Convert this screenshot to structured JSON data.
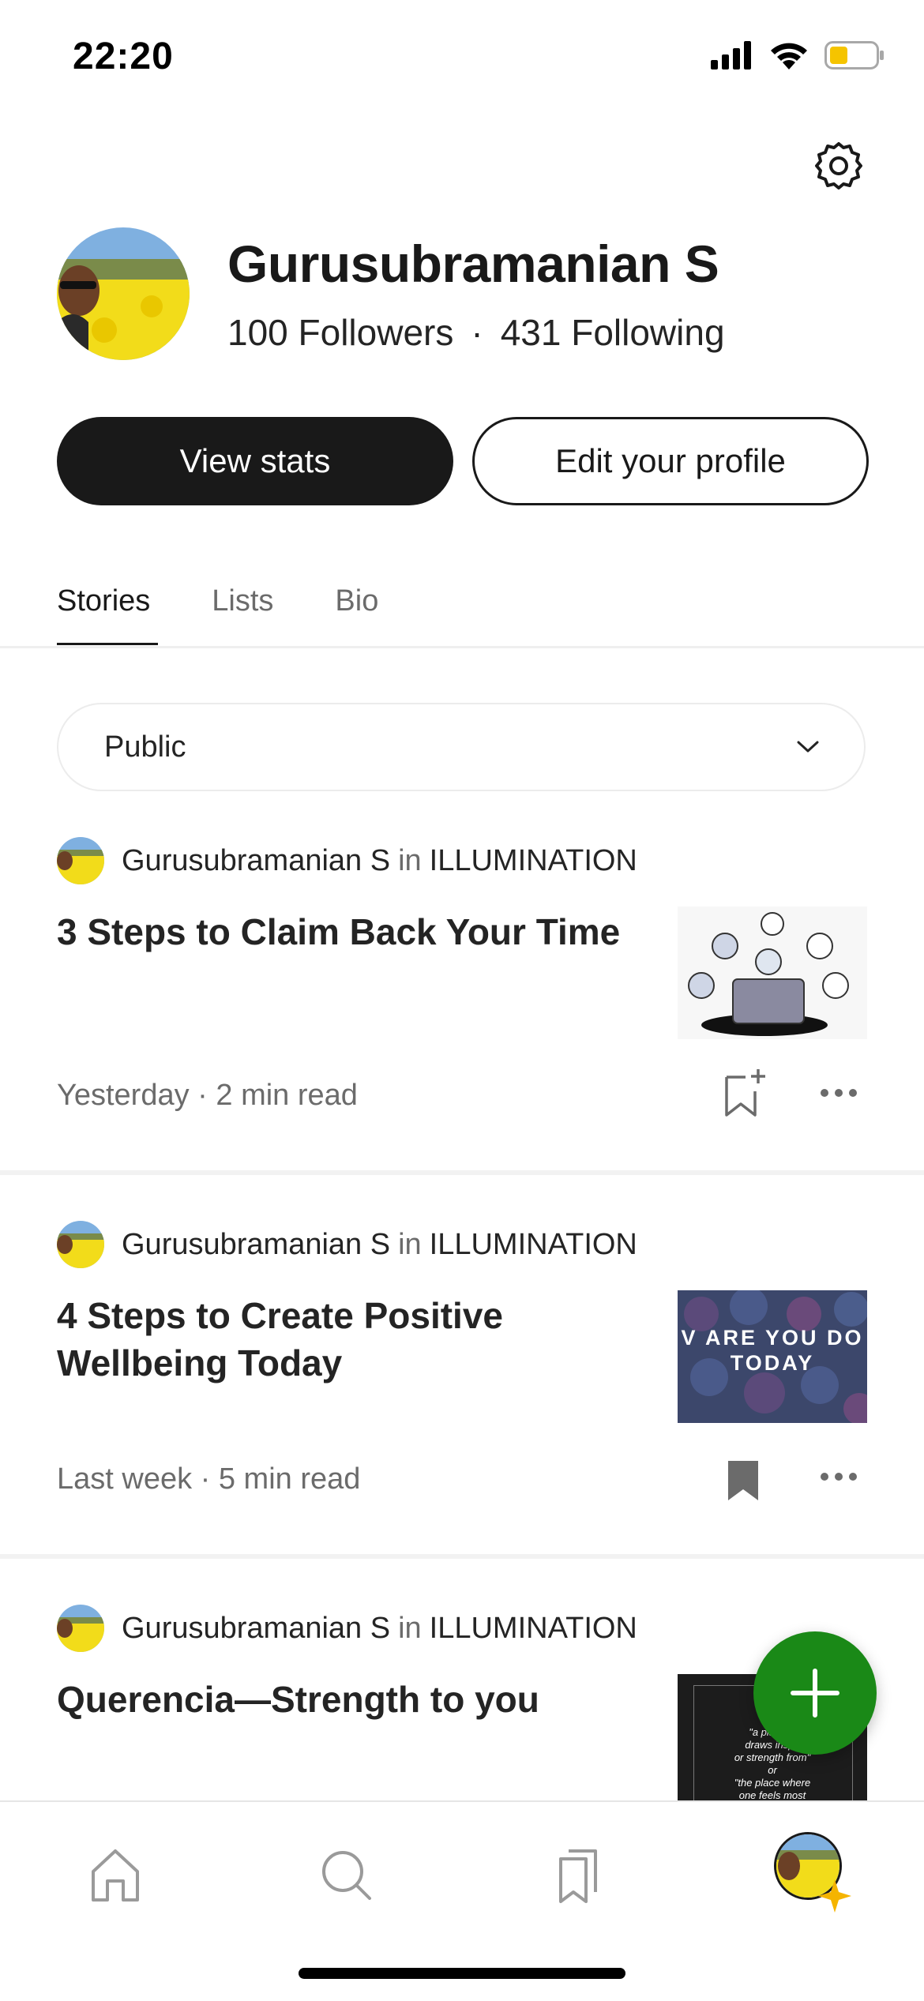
{
  "status_bar": {
    "time": "22:20",
    "battery_color": "#f5c400"
  },
  "profile": {
    "name": "Gurusubramanian S",
    "followers": "100 Followers",
    "separator": "·",
    "following": "431 Following"
  },
  "actions": {
    "view_stats": "View stats",
    "edit_profile": "Edit your profile"
  },
  "tabs": [
    {
      "label": "Stories",
      "active": true
    },
    {
      "label": "Lists",
      "active": false
    },
    {
      "label": "Bio",
      "active": false
    }
  ],
  "filter": {
    "selected": "Public"
  },
  "stories": [
    {
      "author": "Gurusubramanian S",
      "in": "in",
      "publication": "ILLUMINATION",
      "title": "3 Steps to Claim Back Your Time",
      "meta": "Yesterday · 2 min read",
      "bookmarked": false
    },
    {
      "author": "Gurusubramanian S",
      "in": "in",
      "publication": "ILLUMINATION",
      "title": "4 Steps to Create Positive Wellbeing Today",
      "meta": "Last week · 5 min read",
      "bookmarked": true,
      "thumb_text_1": "V ARE YOU DO",
      "thumb_text_2": "TODAY"
    },
    {
      "author": "Gurusubramanian S",
      "in": "in",
      "publication": "ILLUMINATION",
      "title": "Querencia—Strength to you",
      "thumb_lines": [
        "\"a place w",
        "draws inspir",
        "or strength from\"",
        "or",
        "\"the place where",
        "one feels most"
      ]
    }
  ],
  "colors": {
    "accent": "#1a8917",
    "dark": "#191919",
    "muted": "#6b6b6b"
  },
  "nav": [
    "home-icon",
    "search-icon",
    "library-icon",
    "profile-avatar"
  ]
}
